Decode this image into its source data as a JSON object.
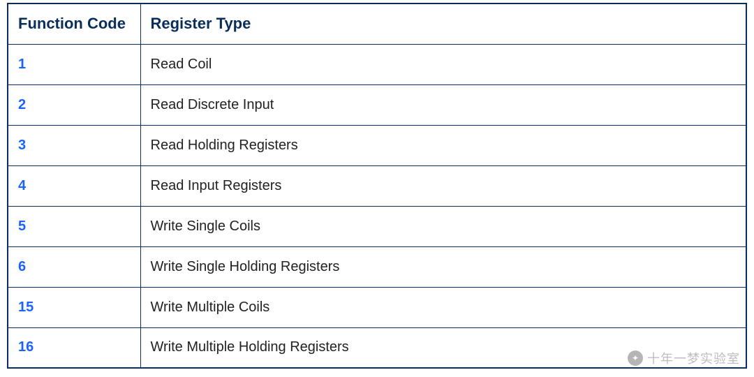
{
  "chart_data": {
    "type": "table",
    "title": "",
    "columns": [
      "Function Code",
      "Register Type"
    ],
    "rows": [
      [
        "1",
        "Read Coil"
      ],
      [
        "2",
        "Read Discrete Input"
      ],
      [
        "3",
        "Read Holding Registers"
      ],
      [
        "4",
        "Read Input Registers"
      ],
      [
        "5",
        "Write Single Coils"
      ],
      [
        "6",
        "Write Single Holding Registers"
      ],
      [
        "15",
        "Write Multiple Coils"
      ],
      [
        "16",
        "Write Multiple Holding Registers"
      ]
    ]
  },
  "table": {
    "headers": {
      "code": "Function Code",
      "type": "Register Type"
    },
    "rows": [
      {
        "code": "1",
        "type": "Read Coil"
      },
      {
        "code": "2",
        "type": "Read Discrete Input"
      },
      {
        "code": "3",
        "type": "Read Holding Registers"
      },
      {
        "code": "4",
        "type": "Read Input Registers"
      },
      {
        "code": "5",
        "type": "Write Single Coils"
      },
      {
        "code": "6",
        "type": "Write Single Holding Registers"
      },
      {
        "code": "15",
        "type": "Write Multiple Coils"
      },
      {
        "code": "16",
        "type": "Write Multiple Holding Registers"
      }
    ]
  },
  "watermark": {
    "icon_glyph": "✦",
    "text": "十年一梦实验室"
  },
  "colors": {
    "border": "#0a2e5c",
    "header_text": "#0a2e5c",
    "code_text": "#1963ff",
    "body_text": "#222222"
  }
}
